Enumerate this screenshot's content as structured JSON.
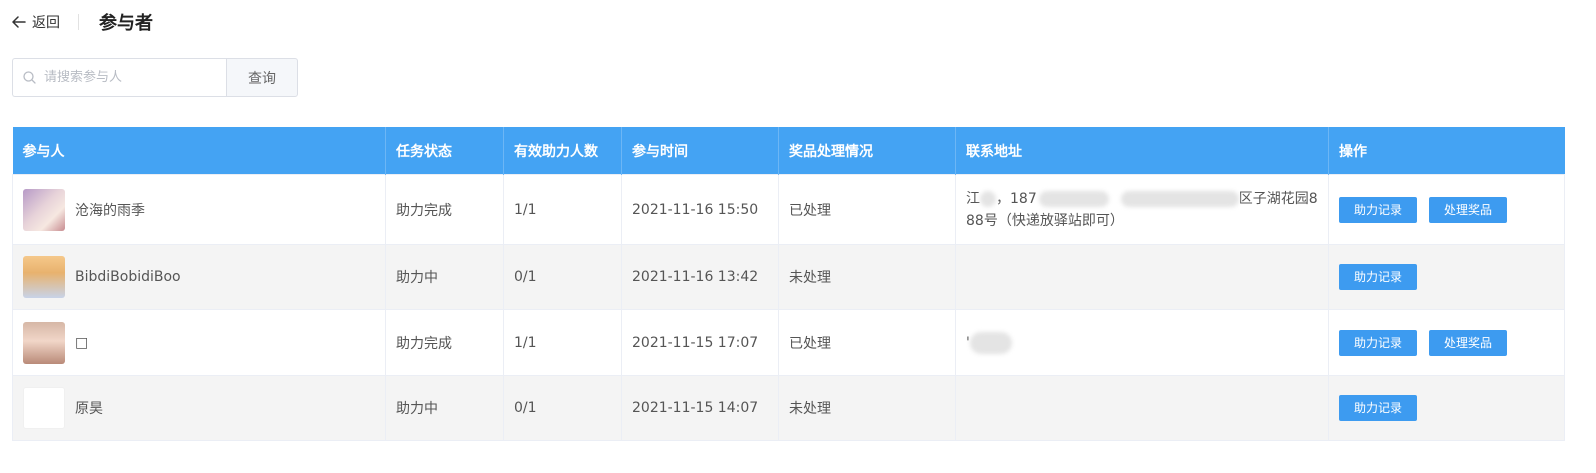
{
  "header": {
    "back_label": "返回",
    "title": "参与者"
  },
  "search": {
    "placeholder": "请搜索参与人",
    "button_label": "查询"
  },
  "table": {
    "columns": [
      "参与人",
      "任务状态",
      "有效助力人数",
      "参与时间",
      "奖品处理情况",
      "联系地址",
      "操作"
    ],
    "rows": [
      {
        "name": "沧海的雨季",
        "status": "助力完成",
        "count": "1/1",
        "time": "2021-11-16 15:50",
        "prize": "已处理",
        "addr_a": "江",
        "addr_b": "，187",
        "addr_c": "区子湖花园8",
        "addr_d": "88号（快递放驿站即可）",
        "btn_record": "助力记录",
        "btn_prize": "处理奖品"
      },
      {
        "name": "BibdiBobidiBoo",
        "status": "助力中",
        "count": "0/1",
        "time": "2021-11-16 13:42",
        "prize": "未处理",
        "btn_record": "助力记录"
      },
      {
        "name": "□",
        "status": "助力完成",
        "count": "1/1",
        "time": "2021-11-15 17:07",
        "prize": "已处理",
        "addr_a": "'",
        "btn_record": "助力记录",
        "btn_prize": "处理奖品"
      },
      {
        "name": "原昊",
        "status": "助力中",
        "count": "0/1",
        "time": "2021-11-15 14:07",
        "prize": "未处理",
        "btn_record": "助力记录"
      }
    ]
  },
  "icons": {
    "back": "arrow-left-icon",
    "search": "search-icon"
  },
  "colors": {
    "header_bg": "#44a3f3",
    "button_bg": "#3d9bf0",
    "stripe": "#f4f4f4"
  }
}
